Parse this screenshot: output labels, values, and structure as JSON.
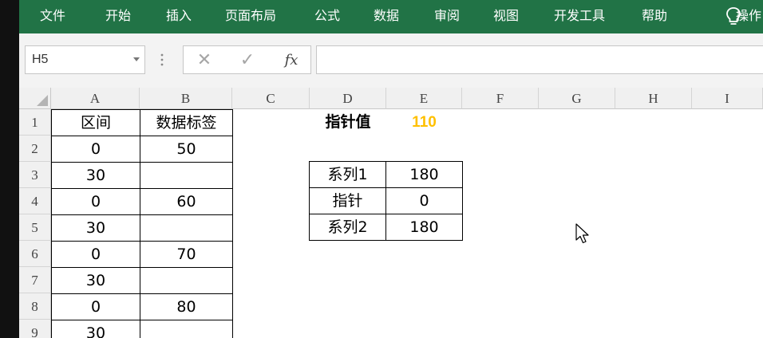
{
  "ribbon": {
    "tabs": [
      "文件",
      "开始",
      "插入",
      "页面布局",
      "公式",
      "数据",
      "审阅",
      "视图",
      "开发工具",
      "帮助"
    ],
    "tell_me": "操作",
    "color": "#217346"
  },
  "formula_bar": {
    "name_box": "H5",
    "cancel": "✕",
    "enter": "✓",
    "fx": "fx",
    "content": ""
  },
  "grid": {
    "columns": [
      "A",
      "B",
      "C",
      "D",
      "E",
      "F",
      "G",
      "H",
      "I"
    ],
    "rows": [
      "1",
      "2",
      "3",
      "4",
      "5",
      "6",
      "7",
      "8",
      "9"
    ]
  },
  "table_a": {
    "header": [
      "区间",
      "数据标签"
    ],
    "rows": [
      [
        "0",
        "50"
      ],
      [
        "30",
        ""
      ],
      [
        "0",
        "60"
      ],
      [
        "30",
        ""
      ],
      [
        "0",
        "70"
      ],
      [
        "30",
        ""
      ],
      [
        "0",
        "80"
      ],
      [
        "30",
        ""
      ]
    ]
  },
  "pointer_value": {
    "label": "指针值",
    "value": "110",
    "value_color": "#ffc000"
  },
  "table_d": {
    "rows": [
      [
        "系列1",
        "180"
      ],
      [
        "指针",
        "0"
      ],
      [
        "系列2",
        "180"
      ]
    ]
  }
}
